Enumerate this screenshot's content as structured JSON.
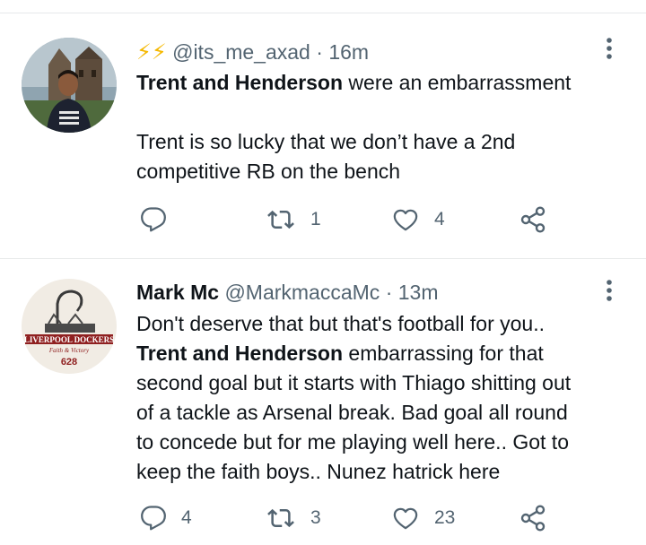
{
  "tweets": [
    {
      "emoji": "⚡⚡",
      "display_name": "",
      "handle": "@its_me_axad",
      "separator": "·",
      "time": "16m",
      "text_lines": [
        {
          "bold": "Trent and Henderson",
          "rest": " were an embarrassment"
        },
        {
          "bold": "",
          "rest": ""
        },
        {
          "bold": "",
          "rest": "Trent is so lucky that we don’t have a 2nd"
        },
        {
          "bold": "",
          "rest": "competitive RB on the bench"
        }
      ],
      "reply_count": "",
      "retweet_count": "1",
      "like_count": "4"
    },
    {
      "emoji": "",
      "display_name": "Mark Mc",
      "handle": "@MarkmaccaMc",
      "separator": "·",
      "time": "13m",
      "text_lines": [
        {
          "bold": "",
          "rest": "Don't deserve that but that's football for you.."
        },
        {
          "bold": "Trent and Henderson",
          "rest": " embarrassing for that"
        },
        {
          "bold": "",
          "rest": "second goal but it starts with Thiago shitting out"
        },
        {
          "bold": "",
          "rest": "of a tackle as Arsenal break. Bad goal all round"
        },
        {
          "bold": "",
          "rest": "to concede but for me playing well here.. Got to"
        },
        {
          "bold": "",
          "rest": "keep the faith boys.. Nunez hatrick here"
        }
      ],
      "avatar_text": [
        "LIVERPOOL DOCKERS",
        "Faith & Victory",
        "628"
      ],
      "reply_count": "4",
      "retweet_count": "3",
      "like_count": "23"
    }
  ],
  "icons": {
    "reply": "reply-icon",
    "retweet": "retweet-icon",
    "like": "heart-icon",
    "share": "share-icon",
    "more": "more-vertical-icon"
  },
  "colors": {
    "text": "#0f1419",
    "secondary": "#536471",
    "divider": "#e7e9ea",
    "bolt": "#f5b800"
  }
}
